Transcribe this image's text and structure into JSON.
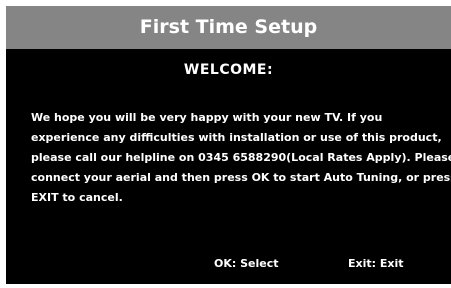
{
  "dialog": {
    "title": "First Time Setup",
    "heading": "WELCOME:",
    "message_lines": [
      "We hope you will be very happy with your new TV. If you",
      "experience any difficulties with installation or use of this product,",
      "please call our helpline on 0345 6588290(Local Rates Apply). Please",
      "connect your aerial and then press OK to start Auto Tuning, or press",
      "EXIT to  cancel."
    ]
  },
  "footer": {
    "ok_hint": "OK: Select",
    "exit_hint": "Exit: Exit"
  },
  "colors": {
    "title_bar": "#858585",
    "background": "#000000",
    "text": "#ffffff"
  }
}
